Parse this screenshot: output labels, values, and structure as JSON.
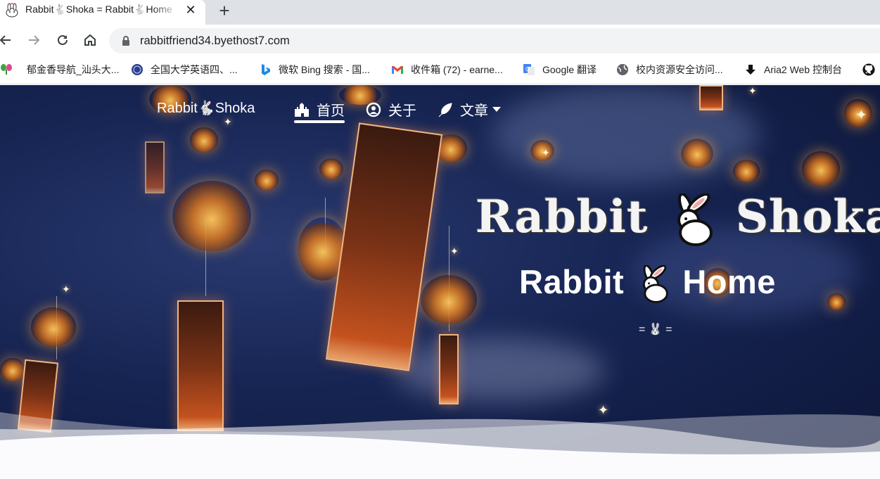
{
  "browser": {
    "tab": {
      "title": "Rabbit🐇Shoka = Rabbit🐇Home",
      "close": "✕"
    },
    "new_tab": "+",
    "url": "rabbitfriend34.byethost7.com"
  },
  "bookmarks": [
    {
      "label": "郁金香导航_汕头大...",
      "icon": "tulip-icon"
    },
    {
      "label": "全国大学英语四、...",
      "icon": "cet-seal-icon"
    },
    {
      "label": "微软 Bing 搜索 - 国...",
      "icon": "bing-icon"
    },
    {
      "label": "收件箱 (72) - earne...",
      "icon": "gmail-icon"
    },
    {
      "label": "Google 翻译",
      "icon": "google-translate-icon"
    },
    {
      "label": "校内资源安全访问...",
      "icon": "globe-icon"
    },
    {
      "label": "Aria2 Web 控制台",
      "icon": "download-arrow-icon"
    },
    {
      "label": "",
      "icon": "github-icon"
    }
  ],
  "site": {
    "brand": "Rabbit🐇Shoka",
    "nav": [
      {
        "label": "首页",
        "icon": "castle-icon",
        "active": true
      },
      {
        "label": "关于",
        "icon": "user-circle-icon"
      },
      {
        "label": "文章",
        "icon": "feather-icon",
        "dropdown": true
      }
    ],
    "hero_title_left": "Rabbit",
    "hero_title_right": "Shoka",
    "hero_subtitle_left": "Rabbit",
    "hero_subtitle_right": "Home",
    "hero_mini": "= 🐰 ="
  },
  "colors": {
    "accent": "#ffffff",
    "night": "#162452",
    "lantern": "#f0a040"
  }
}
